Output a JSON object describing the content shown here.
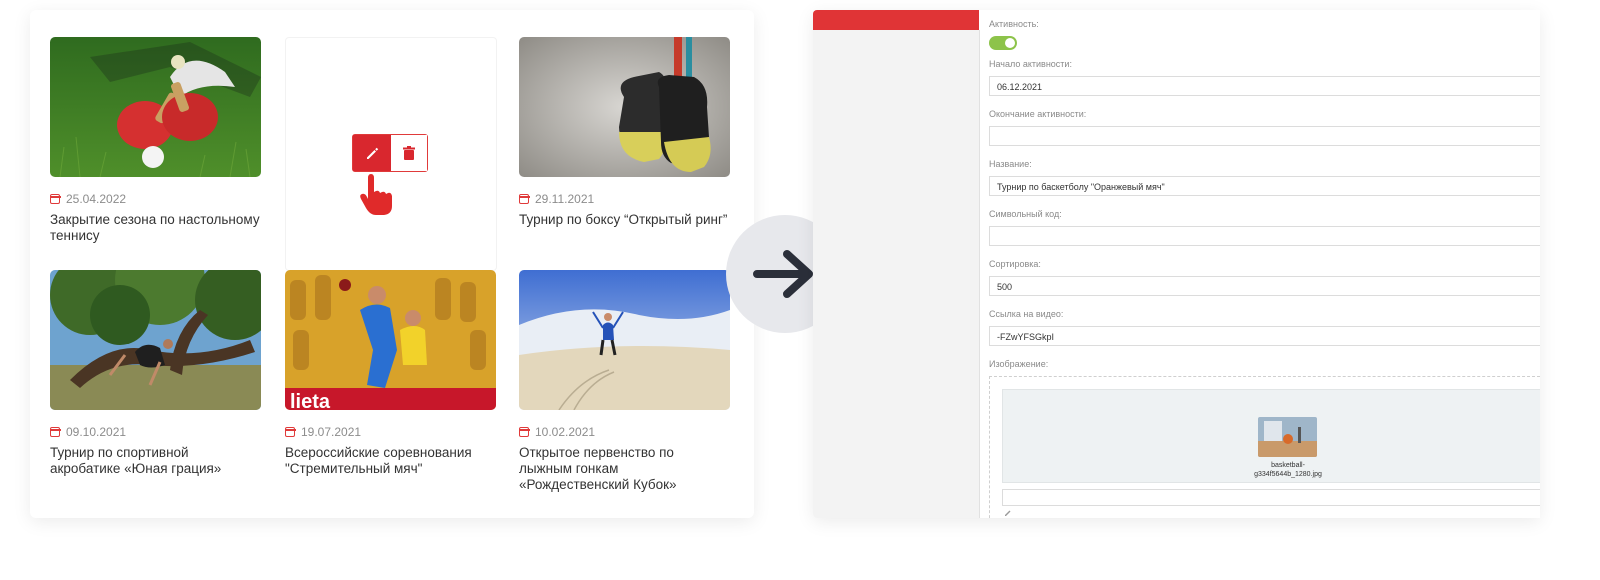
{
  "news": [
    {
      "date": "25.04.2022",
      "title": "Закрытие сезона по настольному теннису"
    },
    {
      "date": "29.11.2021",
      "title": "Турнир по боксу “Открытый ринг”"
    },
    {
      "date": "09.10.2021",
      "title": "Турнир по спортивной акробатике «Юная грация»"
    },
    {
      "date": "19.07.2021",
      "title": "Всероссийские соревнования \"Стремительный мяч\""
    },
    {
      "date": "10.02.2021",
      "title": "Открытое первенство по лыжным гонкам «Рождественский Кубок»"
    }
  ],
  "form": {
    "activity_label": "Активность:",
    "activity_on": true,
    "start_label": "Начало активности:",
    "start_value": "06.12.2021",
    "end_label": "Окончание активности:",
    "end_value": "",
    "name_label": "Название:",
    "name_value": "Турнир по баскетболу \"Оранжевый мяч\"",
    "code_label": "Символьный код:",
    "code_value": "",
    "sort_label": "Сортировка:",
    "sort_value": "500",
    "video_label": "Ссылка на видео:",
    "video_value": "-FZwYFSGkpI",
    "image_label": "Изображение:",
    "image_file_line1": "basketball-",
    "image_file_line2": "g334f5644b_1280.jpg"
  },
  "icons": {
    "edit": "pencil-icon",
    "delete": "trash-icon",
    "cursor": "hand-pointer-icon",
    "arrow": "arrow-right-icon",
    "calendar": "calendar-icon"
  },
  "colors": {
    "accent_red": "#d9272e",
    "toggle_green": "#8dc34a",
    "arrow_bg": "#e7e8ec",
    "arrow_fg": "#2b2f3a"
  }
}
